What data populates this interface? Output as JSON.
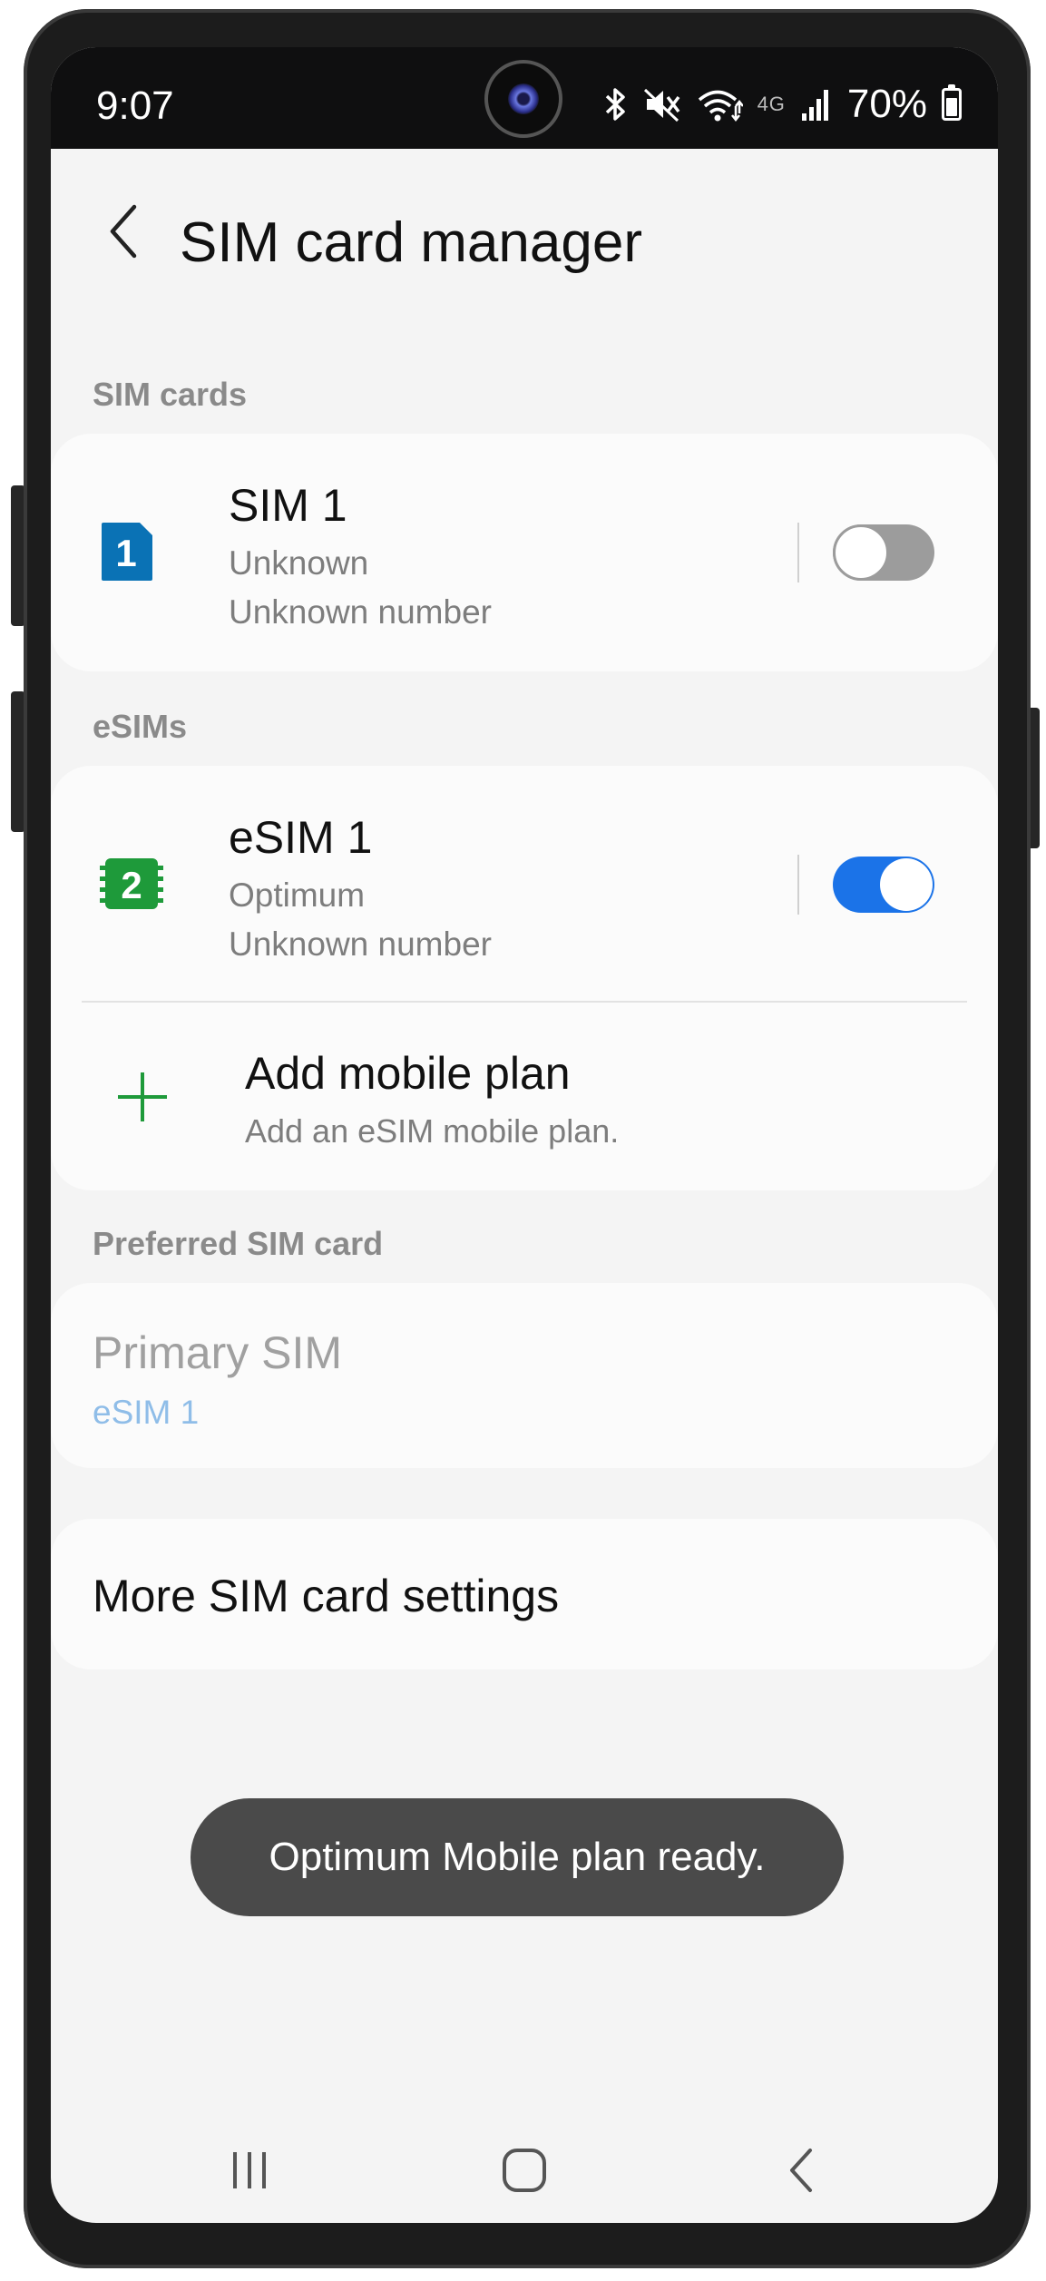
{
  "status_bar": {
    "time": "9:07",
    "battery_percent": "70%",
    "network_label": "4G",
    "icons": [
      "bluetooth-icon",
      "mute-icon",
      "wifi-icon",
      "signal-icon",
      "battery-icon"
    ]
  },
  "header": {
    "title": "SIM card manager",
    "back_icon": "chevron-left-icon"
  },
  "sim_cards": {
    "section_label": "SIM cards",
    "items": [
      {
        "badge": "1",
        "name": "SIM 1",
        "carrier": "Unknown",
        "number": "Unknown number",
        "enabled": false,
        "badge_color": "#0a72b5"
      }
    ]
  },
  "esims": {
    "section_label": "eSIMs",
    "items": [
      {
        "badge": "2",
        "name": "eSIM 1",
        "carrier": "Optimum",
        "number": "Unknown number",
        "enabled": true,
        "badge_color": "#1e9a3a"
      }
    ],
    "add_plan": {
      "title": "Add mobile plan",
      "subtitle": "Add an eSIM mobile plan.",
      "icon": "plus-icon",
      "icon_color": "#1e9a3a"
    }
  },
  "preferred": {
    "section_label": "Preferred SIM card",
    "primary_label": "Primary SIM",
    "primary_value": "eSIM 1"
  },
  "more_settings": {
    "label": "More SIM card settings"
  },
  "toast": {
    "message": "Optimum Mobile plan ready."
  },
  "nav": {
    "recents_icon": "recents-icon",
    "home_icon": "home-icon",
    "back_icon": "back-icon"
  },
  "colors": {
    "toggle_on": "#1b73e8",
    "toggle_off": "#9c9c9c",
    "primary_value": "#8fbde8"
  }
}
